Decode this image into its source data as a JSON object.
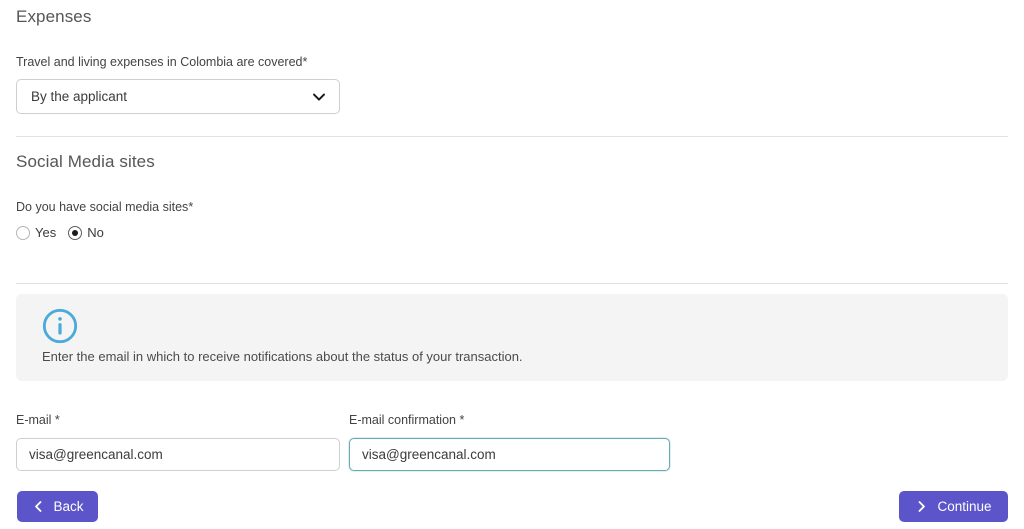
{
  "colors": {
    "primary_purple": "#5b55c9",
    "info_icon_blue": "#4aabdb",
    "focus_border_teal": "#66aab6",
    "divider_gray": "#e2e2e2",
    "info_box_bg": "#f4f4f4",
    "heading_gray": "#565656"
  },
  "expenses": {
    "section_title": "Expenses",
    "question_label": "Travel and living expenses in Colombia are covered",
    "required_mark": "*",
    "select": {
      "selected_value": "By the applicant",
      "icon": "chevron-down-icon",
      "options": [
        "By the applicant"
      ]
    }
  },
  "social_media": {
    "section_title": "Social Media sites",
    "question_label": "Do you have social media sites",
    "required_mark": "*",
    "options": [
      {
        "label": "Yes",
        "value": "yes",
        "checked": false
      },
      {
        "label": "No",
        "value": "no",
        "checked": true
      }
    ]
  },
  "info_banner": {
    "icon": "info-circle-icon",
    "message": "Enter the email in which to receive notifications about the status of your transaction."
  },
  "email_fields": [
    {
      "label": "E-mail",
      "required_mark": "*",
      "value": "visa@greencanal.com",
      "placeholder": "visa@greencanal.com",
      "focused": false
    },
    {
      "label": "E-mail confirmation",
      "required_mark": "*",
      "value": "visa@greencanal.com",
      "placeholder": "visa@greencanal.com",
      "focused": true
    }
  ],
  "footer": {
    "back": {
      "label": "Back",
      "icon": "chevron-left-icon"
    },
    "continue": {
      "label": "Continue",
      "icon": "chevron-right-icon"
    }
  }
}
